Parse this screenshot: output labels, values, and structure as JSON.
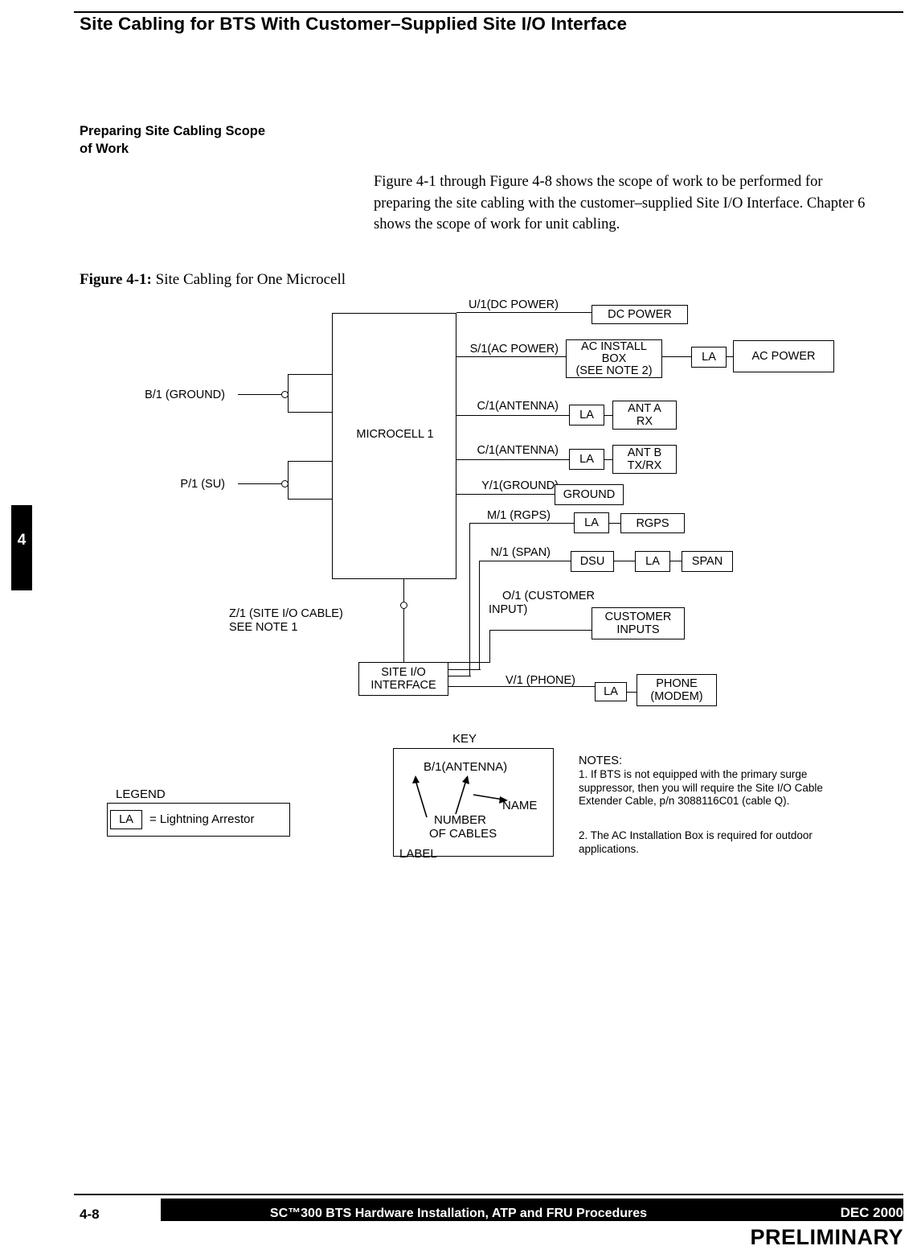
{
  "header": {
    "title": "Site Cabling for BTS With Customer–Supplied Site I/O Interface"
  },
  "section": {
    "heading_line1": "Preparing Site Cabling Scope",
    "heading_line2": "of Work",
    "paragraph": "Figure 4-1 through Figure 4-8 shows the scope of work to be performed for preparing the site cabling with the customer–supplied Site I/O Interface.  Chapter 6 shows the scope of work for unit cabling."
  },
  "figure": {
    "caption_label": "Figure 4-1:",
    "caption_text": " Site Cabling for One Microcell",
    "main_unit": "MICROCELL 1",
    "site_io_line1": "SITE I/O",
    "site_io_line2": "INTERFACE",
    "left_labels": [
      "B/1 (GROUND)",
      "P/1 (SU)"
    ],
    "site_io_cable_line1": "Z/1 (SITE I/O CABLE)",
    "site_io_cable_line2": "SEE NOTE 1",
    "rows": [
      {
        "port": "U/1(DC POWER)",
        "la": false,
        "dest": "DC POWER"
      },
      {
        "port": "S/1(AC POWER)",
        "la": true,
        "dest": "AC POWER",
        "mid_line1": "AC INSTALL",
        "mid_line2": "BOX",
        "mid_line3": "(SEE NOTE 2)"
      },
      {
        "port": "C/1(ANTENNA)",
        "la": true,
        "dest_line1": "ANT A",
        "dest_line2": "RX"
      },
      {
        "port": "C/1(ANTENNA)",
        "la": true,
        "dest_line1": "ANT B",
        "dest_line2": "TX/RX"
      },
      {
        "port": "Y/1(GROUND)",
        "la": false,
        "dest": "GROUND"
      },
      {
        "port": "M/1 (RGPS)",
        "la": true,
        "dest": "RGPS"
      },
      {
        "port": "N/1 (SPAN)",
        "la": true,
        "dest": "SPAN",
        "mid": "DSU"
      },
      {
        "port_line1": "O/1 (CUSTOMER",
        "port_line2": "INPUT)",
        "la": false,
        "dest_line1": "CUSTOMER",
        "dest_line2": "INPUTS"
      },
      {
        "port": "V/1 (PHONE)",
        "la": true,
        "dest_line1": "PHONE",
        "dest_line2": "(MODEM)"
      }
    ],
    "la_label": "LA",
    "dsu_label": "DSU"
  },
  "key": {
    "title": "KEY",
    "sample": "B/1(ANTENNA)",
    "name_label": "NAME",
    "number_line1": "NUMBER",
    "number_line2": "OF CABLES",
    "label_label": "LABEL"
  },
  "legend": {
    "title": "LEGEND",
    "box": "LA",
    "text": "= Lightning  Arrestor"
  },
  "notes": {
    "title": "NOTES:",
    "note1": "1.  If BTS is not equipped with the primary surge suppressor, then you will require the Site I/O Cable Extender Cable, p/n 3088116C01 (cable Q).",
    "note2": "2.  The AC Installation Box is required for outdoor applications."
  },
  "chapter_tab": {
    "number": "4"
  },
  "footer": {
    "page": "4-8",
    "title": "SC™300 BTS Hardware Installation, ATP and FRU Procedures",
    "date": "DEC 2000",
    "status": "PRELIMINARY"
  }
}
